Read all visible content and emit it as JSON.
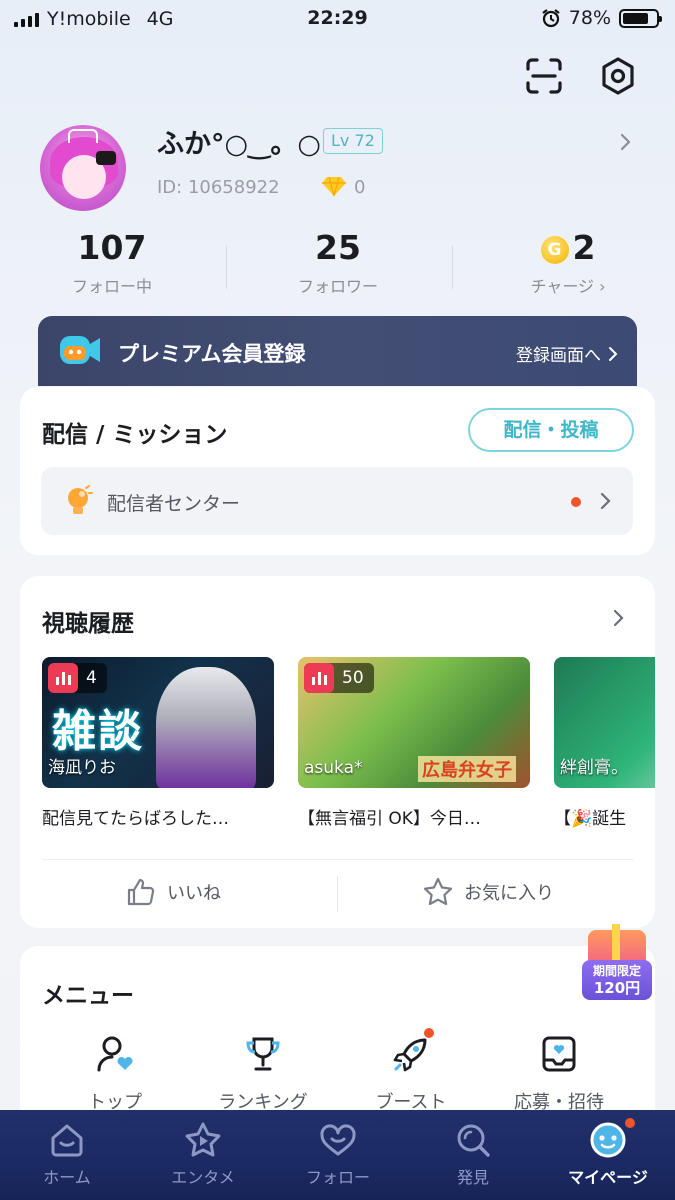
{
  "status_bar": {
    "carrier": "Y!mobile",
    "network": "4G",
    "time": "22:29",
    "battery": "78%",
    "battery_level": 0.78
  },
  "profile": {
    "name": "ふか°○‿。○",
    "level": "Lv 72",
    "user_id": "ID: 10658922",
    "diamonds": "0"
  },
  "stats": {
    "following_value": "107",
    "following_label": "フォロー中",
    "followers_value": "25",
    "followers_label": "フォロワー",
    "coins_value": "2",
    "coins_label": "チャージ",
    "coin_symbol": "G"
  },
  "premium": {
    "title": "プレミアム会員登録",
    "cta": "登録画面へ"
  },
  "mission": {
    "title": "配信 / ミッション",
    "button": "配信・投稿",
    "streamer_center": "配信者センター"
  },
  "history": {
    "title": "視聴履歴",
    "items": [
      {
        "viewers": "4",
        "streamer": "海凪りお",
        "title": "配信見てたらばろした…",
        "big_text": "雑談"
      },
      {
        "viewers": "50",
        "streamer": "asuka*",
        "title": "【無言福引 OK】今日…",
        "overlay": "広島弁女子"
      },
      {
        "viewers": "",
        "streamer": "絆創膏。",
        "title": "【🎉誕生"
      }
    ],
    "like_label": "いいね",
    "favorite_label": "お気に入り"
  },
  "menu": {
    "title": "メニュー",
    "items": [
      {
        "label": "トップ",
        "icon": "user-heart-icon"
      },
      {
        "label": "ランキング",
        "icon": "trophy-icon"
      },
      {
        "label": "ブースト",
        "icon": "rocket-icon"
      },
      {
        "label": "応募・招待",
        "icon": "inbox-heart-icon"
      }
    ]
  },
  "promo": {
    "line1": "期間限定",
    "line2": "120円"
  },
  "bottom_nav": {
    "items": [
      {
        "label": "ホーム",
        "icon": "home-icon"
      },
      {
        "label": "エンタメ",
        "icon": "star-play-icon"
      },
      {
        "label": "フォロー",
        "icon": "heart-chat-icon"
      },
      {
        "label": "発見",
        "icon": "search-icon"
      },
      {
        "label": "マイページ",
        "icon": "face-icon"
      }
    ]
  },
  "colors": {
    "accent_teal": "#3fb7c9",
    "alert_red": "#f0542a",
    "nav_bg": "#1b2a64",
    "premium_bg": "#3b4569"
  }
}
